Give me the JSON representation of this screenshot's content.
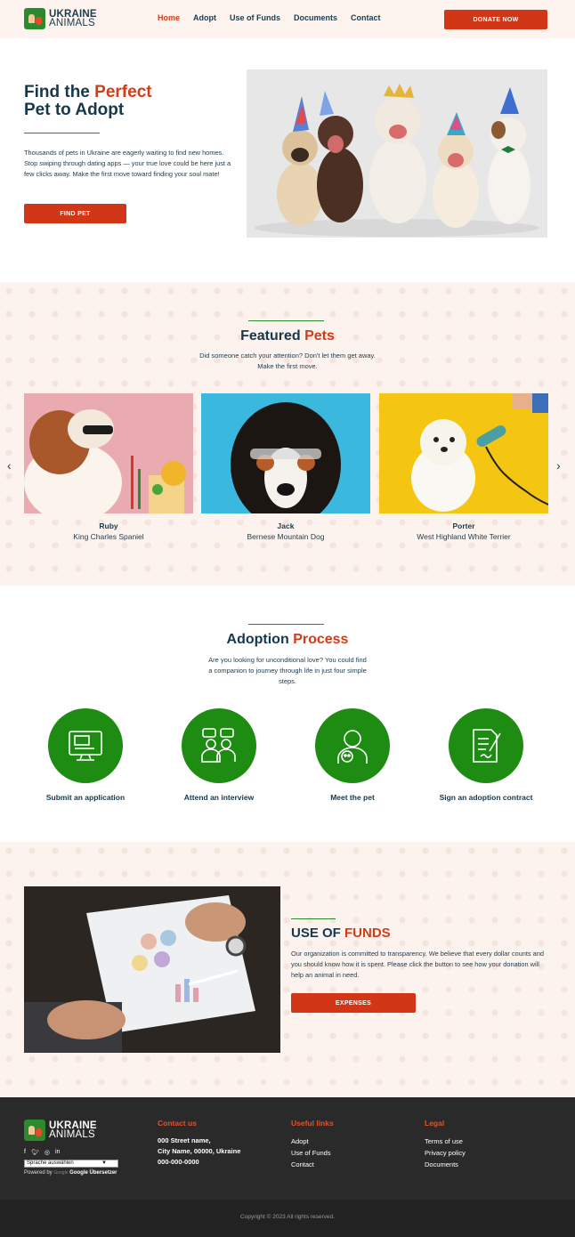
{
  "header": {
    "logo_line1": "UKRAINE",
    "logo_line2": "ANIMALS",
    "nav": [
      "Home",
      "Adopt",
      "Use of Funds",
      "Documents",
      "Contact"
    ],
    "active_nav": "Home",
    "donate_label": "DONATE NOW"
  },
  "hero": {
    "title_part1": "Find the",
    "title_accent": "Perfect",
    "title_line2": "Pet to Adopt",
    "text": "Thousands of pets in Ukraine are eagerly waiting to find new homes. Stop swiping through dating apps — your true love could be here just a few clicks away. Make the first move toward finding your soul mate!",
    "button_label": "FIND PET"
  },
  "featured": {
    "title": "Featured",
    "title_accent": "Pets",
    "subtitle": "Did someone catch your attention? Don't let them get away. Make the first move.",
    "pets": [
      {
        "name": "Ruby",
        "breed": "King Charles Spaniel"
      },
      {
        "name": "Jack",
        "breed": "Bernese Mountain Dog"
      },
      {
        "name": "Porter",
        "breed": "West Highland White Terrier"
      }
    ]
  },
  "process": {
    "title": "Adoption",
    "title_accent": "Process",
    "subtitle": "Are you looking for unconditional love? You could find a companion to journey through life in just four simple steps.",
    "steps": [
      {
        "label": "Submit an application",
        "icon": "computer-form-icon"
      },
      {
        "label": "Attend an interview",
        "icon": "interview-icon"
      },
      {
        "label": "Meet the pet",
        "icon": "person-with-pet-icon"
      },
      {
        "label": "Sign an adoption contract",
        "icon": "contract-sign-icon"
      }
    ]
  },
  "funds": {
    "title": "USE OF",
    "title_accent": "FUNDS",
    "text": "Our organization is committed to transparency. We believe that every dollar counts and you should know how it is spent. Please click the button to see how your donation will help an animal in need.",
    "button_label": "EXPENSES"
  },
  "footer": {
    "logo_line1": "UKRAINE",
    "logo_line2": "ANIMALS",
    "social": [
      "facebook-icon",
      "twitter-icon",
      "instagram-icon",
      "linkedin-icon"
    ],
    "language_select": "Sprache auswählen",
    "powered_by": "Powered by",
    "google_label": "Google",
    "translator_label": "Google Übersetzer",
    "contact_head": "Contact us",
    "contact_lines": [
      "000 Street name,",
      "City Name, 00000, Ukraine",
      "000-000-0000"
    ],
    "useful_head": "Useful links",
    "useful_links": [
      "Adopt",
      "Use of Funds",
      "Contact"
    ],
    "legal_head": "Legal",
    "legal_links": [
      "Terms of use",
      "Privacy policy",
      "Documents"
    ],
    "copyright": "Copyright © 2023 All rights reserved."
  },
  "colors": {
    "accent_red": "#d13617",
    "brand_green": "#1e8c12",
    "navy_text": "#16384a",
    "peach_bg": "#fdf3ee",
    "footer_bg": "#2a2a2a"
  }
}
